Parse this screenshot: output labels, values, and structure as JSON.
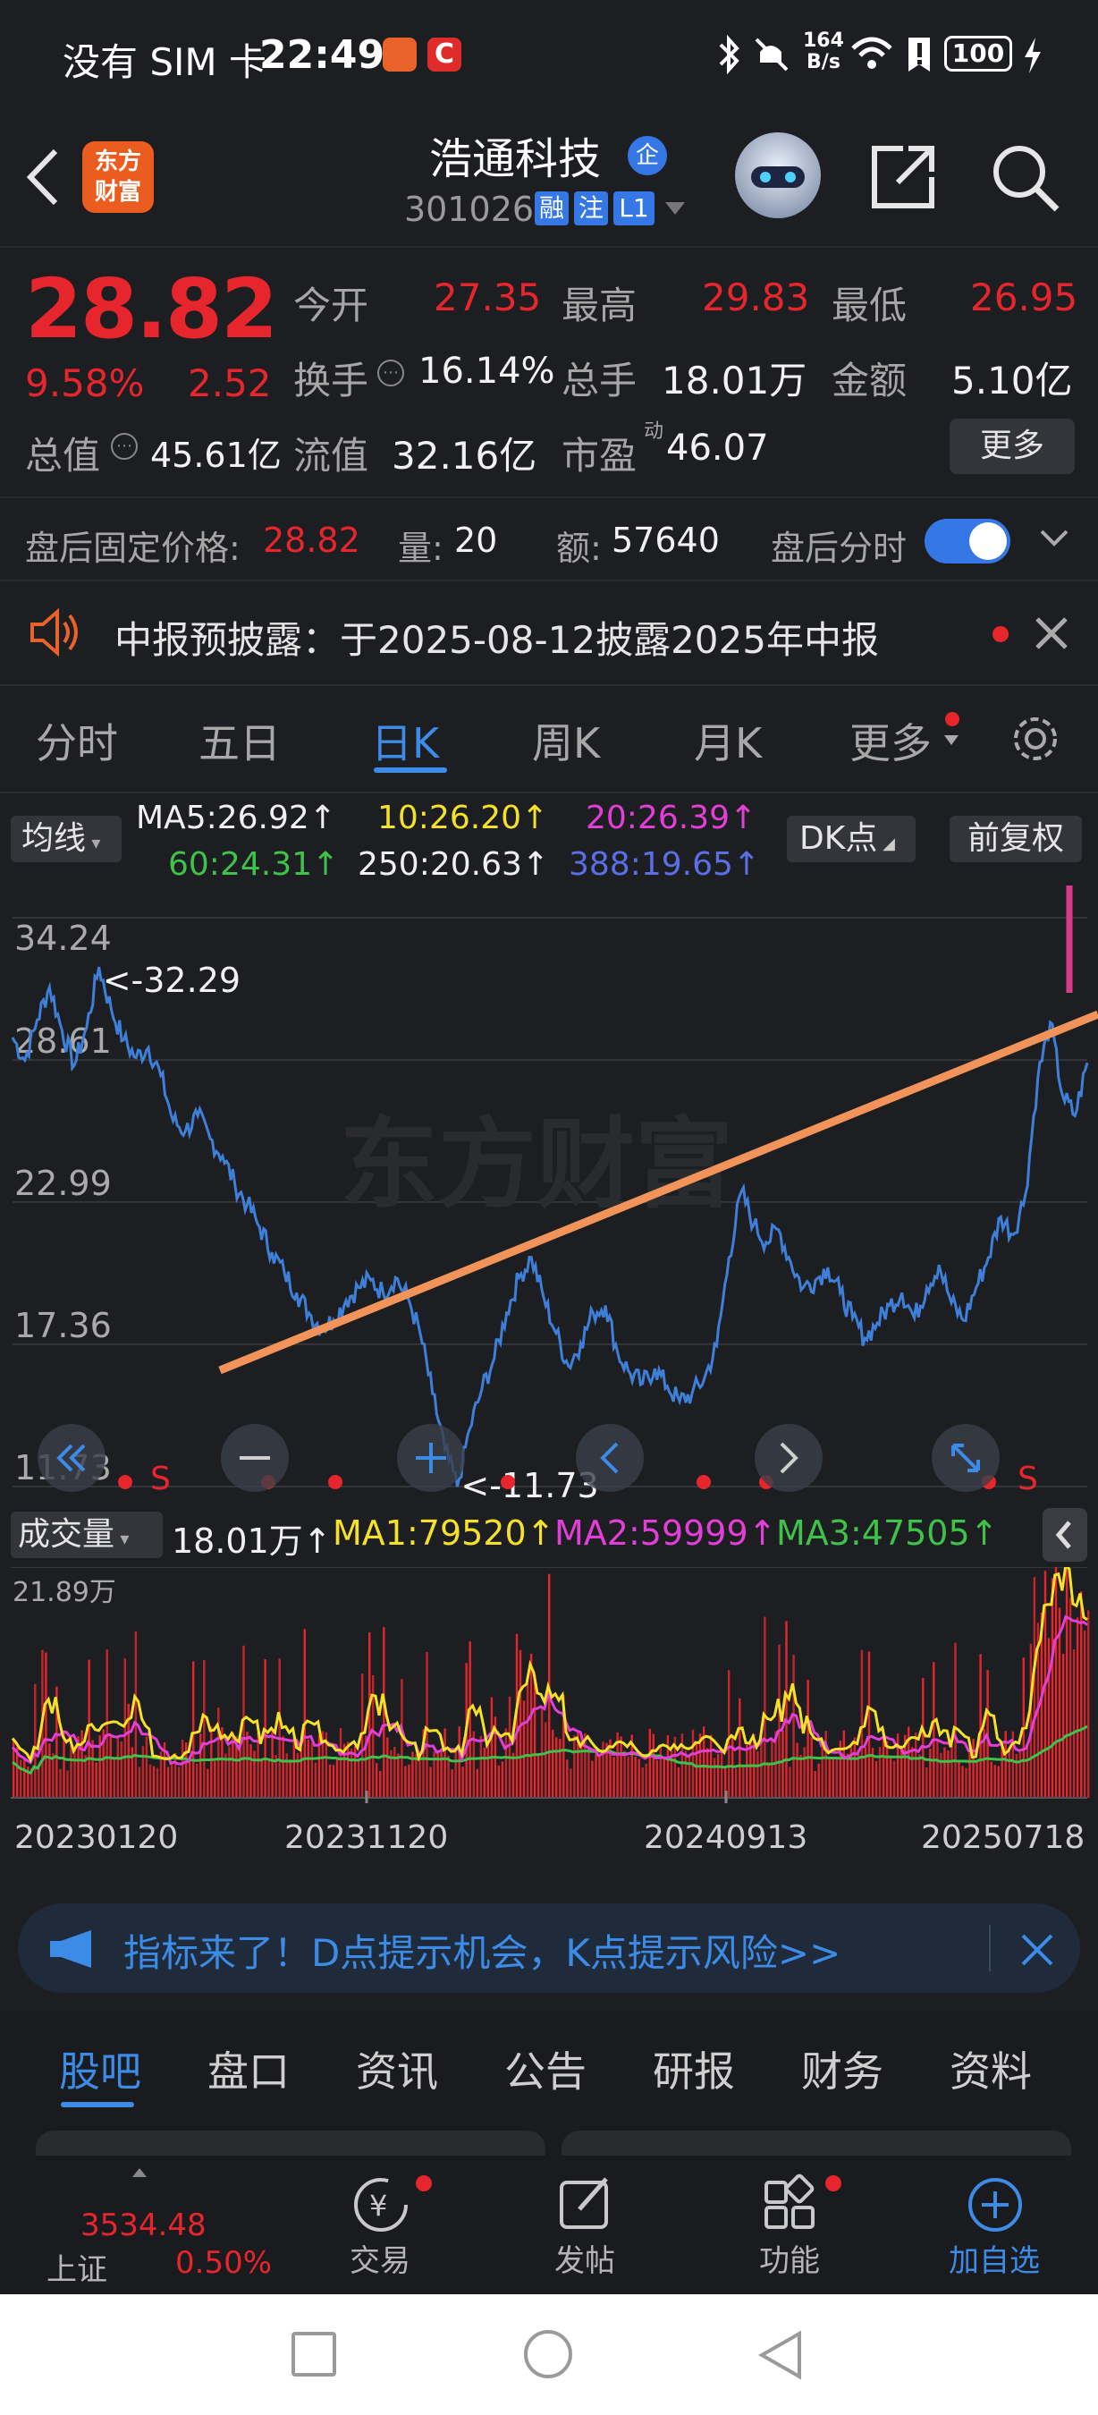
{
  "status_bar": {
    "carrier": "没有 SIM 卡",
    "time": "22:49",
    "net_speed_top": "164",
    "net_speed_unit": "B/s",
    "battery": "100"
  },
  "header": {
    "app_logo_line1": "东方",
    "app_logo_line2": "财富",
    "stock_name": "浩通科技",
    "name_badge": "企",
    "stock_code": "301026",
    "tag_margin": "融",
    "tag_watch": "注",
    "tag_level": "L1"
  },
  "quote": {
    "price": "28.82",
    "change_pct": "9.58%",
    "change_amt": "2.52",
    "open_label": "今开",
    "open": "27.35",
    "high_label": "最高",
    "high": "29.83",
    "low_label": "最低",
    "low": "26.95",
    "turnover_label": "换手",
    "turnover": "16.14%",
    "volume_label": "总手",
    "volume": "18.01万",
    "amount_label": "金额",
    "amount": "5.10亿",
    "mktcap_label": "总值",
    "mktcap": "45.61亿",
    "float_label": "流值",
    "float_cap": "32.16亿",
    "pe_label": "市盈",
    "pe_sup": "动",
    "pe": "46.07",
    "more_button": "更多"
  },
  "after_hours": {
    "price_label": "盘后固定价格:",
    "price": "28.82",
    "vol_label": "量:",
    "vol": "20",
    "amt_label": "额:",
    "amt": "57640",
    "toggle_label": "盘后分时",
    "toggle_on": true
  },
  "notice": {
    "text": "中报预披露：于2025-08-12披露2025年中报"
  },
  "chart_tabs": [
    "分时",
    "五日",
    "日K",
    "周K",
    "月K",
    "更多"
  ],
  "active_tab": "日K",
  "ma_bar": {
    "selector": "均线",
    "ma5": "MA5:26.92↑",
    "ma10": "10:26.20↑",
    "ma20": "20:26.39↑",
    "ma60": "60:24.31↑",
    "ma250": "250:20.63↑",
    "ma388": "388:19.65↑",
    "dk_button": "DK点",
    "adjust_button": "前复权"
  },
  "price_axis": [
    "34.24",
    "28.61",
    "22.99",
    "17.36",
    "11.73"
  ],
  "annotations": {
    "high_mark": "<-32.29",
    "low_mark": "<-11.73",
    "s_signal": "S"
  },
  "volume_bar": {
    "selector": "成交量",
    "vol": "18.01万↑",
    "ma1": "MA1:79520↑",
    "ma2": "MA2:59999↑",
    "ma3": "MA3:47505↑",
    "max_label": "21.89万"
  },
  "date_axis": [
    "20230120",
    "20231120",
    "20240913",
    "20250718"
  ],
  "promo": {
    "text": "指标来了！D点提示机会，K点提示风险>>"
  },
  "bottom_tabs": [
    "股吧",
    "盘口",
    "资讯",
    "公告",
    "研报",
    "财务",
    "资料"
  ],
  "bottom_nav": {
    "index_value": "3534.48",
    "index_name": "上证",
    "index_change": "0.50%",
    "trade": "交易",
    "post": "发帖",
    "features": "功能",
    "add_watch": "加自选"
  },
  "colors": {
    "up_red": "#e6262c",
    "price_line": "#3d7fd9",
    "trend_line": "#f2945a",
    "arrow": "#d63c8a",
    "accent_blue": "#3c8ce7",
    "ma1_yellow": "#f5e02a",
    "ma2_magenta": "#e33fd8",
    "ma3_green": "#3fc24a"
  },
  "chart_data": {
    "type": "line",
    "y_axis_ticks": [
      "34.24",
      "28.61",
      "22.99",
      "17.36",
      "11.73"
    ],
    "ylim": [
      11.73,
      34.24
    ],
    "x_axis_ticks": [
      "20230120",
      "20231120",
      "20240913",
      "20250718"
    ],
    "annotated_high": 32.29,
    "annotated_low": 11.73,
    "close_series": [
      29.5,
      28.6,
      30.2,
      31.5,
      29.8,
      28.4,
      29.9,
      32.29,
      30.6,
      29.4,
      28.7,
      29.1,
      28.0,
      26.2,
      25.8,
      26.4,
      25.5,
      24.8,
      23.7,
      22.9,
      22.0,
      21.0,
      20.2,
      19.4,
      18.6,
      18.0,
      18.3,
      19.1,
      19.6,
      19.9,
      19.4,
      20.0,
      19.2,
      17.8,
      15.4,
      13.2,
      11.73,
      14.0,
      15.6,
      16.8,
      18.6,
      20.0,
      20.8,
      19.2,
      17.8,
      16.5,
      17.4,
      18.6,
      18.9,
      17.0,
      16.2,
      15.8,
      16.4,
      15.7,
      15.1,
      15.4,
      16.0,
      17.3,
      20.8,
      23.4,
      22.1,
      21.4,
      21.9,
      20.6,
      19.6,
      19.9,
      20.4,
      19.4,
      18.4,
      17.6,
      18.2,
      18.9,
      19.4,
      18.4,
      19.6,
      20.5,
      19.0,
      18.3,
      19.6,
      20.8,
      22.4,
      21.7,
      23.3,
      27.9,
      30.1,
      27.2,
      26.4,
      28.5
    ]
  }
}
